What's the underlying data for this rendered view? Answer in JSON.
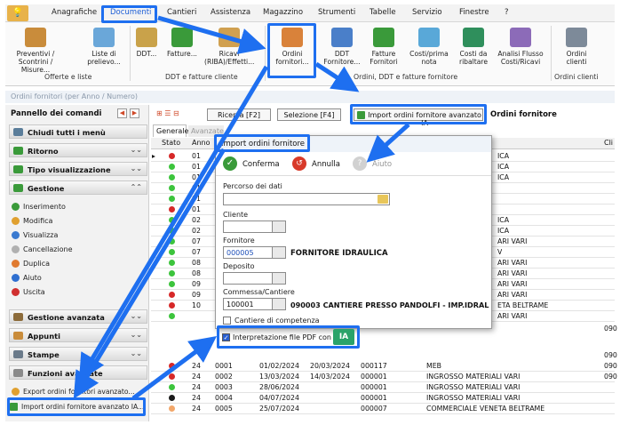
{
  "menu": {
    "items": [
      "Anagrafiche",
      "Documenti",
      "Cantieri",
      "Assistenza",
      "Magazzino",
      "Strumenti",
      "Tabelle",
      "Servizio",
      "Finestre",
      "?"
    ]
  },
  "ribbon": {
    "buttons": [
      "Preventivi / Scontrini / Misure...",
      "Liste di prelievo...",
      "DDT...",
      "Fatture...",
      "Ricavi (RIBA)/Effetti...",
      "Ordini fornitori...",
      "DDT Fornitore...",
      "Fatture Fornitori",
      "Costi/prima nota",
      "Costi da ribaltare",
      "Analisi Flusso Costi/Ricavi",
      "Ordini clienti"
    ],
    "groups": [
      "Offerte e liste",
      "DDT e fatture cliente",
      "Ordini, DDT e fatture fornitore",
      "Ordini clienti"
    ]
  },
  "window": {
    "title": "Ordini fornitori (per Anno / Numero)"
  },
  "panel": {
    "title": "Pannello dei comandi",
    "close_all": "Chiudi tutti i menù",
    "sections": {
      "ritorno": "Ritorno",
      "tipo": "Tipo visualizzazione",
      "gestione": "Gestione",
      "gestione_avanzata": "Gestione avanzata",
      "appunti": "Appunti",
      "stampe": "Stampe",
      "funzioni": "Funzioni avanzate"
    },
    "items": [
      "Inserimento",
      "Modifica",
      "Visualizza",
      "Cancellazione",
      "Duplica",
      "Aiuto",
      "Uscita"
    ],
    "export_label": "Export ordini fornitori avanzato...",
    "import_label": "Import ordini fornitore avanzato IA..."
  },
  "toolbar": {
    "ricerca": "Ricerca [F2]",
    "selezione": "Selezione [F4]",
    "import_ia": "Import ordini fornitore avanzato IA",
    "title_right": "Ordini fornitore"
  },
  "grid": {
    "tab_generale": "Generale",
    "tab_avanzate": "Avanzate",
    "header_stato": "Stato",
    "header_anno": "Anno",
    "header_cli": "Cli",
    "rows_top": [
      {
        "anno": "01",
        "color": "#d62828",
        "desc": "ICA"
      },
      {
        "anno": "01",
        "color": "#3cc43c",
        "desc": "ICA"
      },
      {
        "anno": "01",
        "color": "#3cc43c",
        "desc": "ICA"
      },
      {
        "anno": "01",
        "color": "#3cc43c",
        "desc": ""
      },
      {
        "anno": "01",
        "color": "#3cc43c",
        "desc": ""
      },
      {
        "anno": "01",
        "color": "#d62828",
        "desc": ""
      },
      {
        "anno": "02",
        "color": "#3cc43c",
        "desc": "ICA"
      },
      {
        "anno": "02",
        "color": "#3cc43c",
        "desc": "ICA"
      },
      {
        "anno": "07",
        "color": "#3cc43c",
        "desc": "ARI VARI"
      },
      {
        "anno": "07",
        "color": "#3cc43c",
        "desc": "V"
      },
      {
        "anno": "08",
        "color": "#3cc43c",
        "desc": "ARI VARI"
      },
      {
        "anno": "08",
        "color": "#3cc43c",
        "desc": "ARI VARI"
      },
      {
        "anno": "09",
        "color": "#3cc43c",
        "desc": "ARI VARI"
      },
      {
        "anno": "09",
        "color": "#d62828",
        "desc": "ARI VARI"
      },
      {
        "anno": "10",
        "color": "#d62828",
        "desc": "ETA BELTRAME"
      },
      {
        "anno": "",
        "color": "#3cc43c",
        "desc": "ARI VARI"
      }
    ],
    "rows_bottom": [
      {
        "anno": "24",
        "num": "0001",
        "data": "01/02/2024",
        "data2": "20/03/2024",
        "cod": "000117",
        "desc": "MEB",
        "color": "#d62828"
      },
      {
        "anno": "24",
        "num": "0002",
        "data": "13/03/2024",
        "data2": "14/03/2024",
        "cod": "000001",
        "desc": "INGROSSO MATERIALI VARI",
        "color": "#d62828"
      },
      {
        "anno": "24",
        "num": "0003",
        "data": "28/06/2024",
        "data2": "",
        "cod": "000001",
        "desc": "INGROSSO MATERIALI VARI",
        "color": "#3cc43c"
      },
      {
        "anno": "24",
        "num": "0004",
        "data": "04/07/2024",
        "data2": "",
        "cod": "000001",
        "desc": "INGROSSO MATERIALI VARI",
        "color": "#1a1a1a"
      },
      {
        "anno": "24",
        "num": "0005",
        "data": "25/07/2024",
        "data2": "",
        "cod": "000007",
        "desc": "COMMERCIALE VENETA BELTRAME",
        "color": "#f2a76a"
      }
    ],
    "right_codes": {
      "r1": "090",
      "r2": "090",
      "r3": "090",
      "r4": "090"
    }
  },
  "dialog": {
    "title": "Import ordini fornitore",
    "conferma": "Conferma",
    "annulla": "Annulla",
    "aiuto": "Aiuto",
    "percorso_label": "Percorso dei dati",
    "percorso_value": "",
    "cliente_label": "Cliente",
    "cliente_value": "",
    "fornitore_label": "Fornitore",
    "fornitore_code": "000005",
    "fornitore_name": "FORNITORE IDRAULICA",
    "deposito_label": "Deposito",
    "deposito_value": "",
    "commessa_label": "Commessa/Cantiere",
    "commessa_code": "100001",
    "commessa_name": "090003 CANTIERE PRESSO PANDOLFI - IMP.IDRAL",
    "cantiere_label": "Cantiere di competenza",
    "pdf_label": "Interpretazione file PDF con IA",
    "ia_badge": "IA"
  },
  "colors": {
    "highlight": "#1e6ff0",
    "section_green": "#3a9a3a"
  }
}
